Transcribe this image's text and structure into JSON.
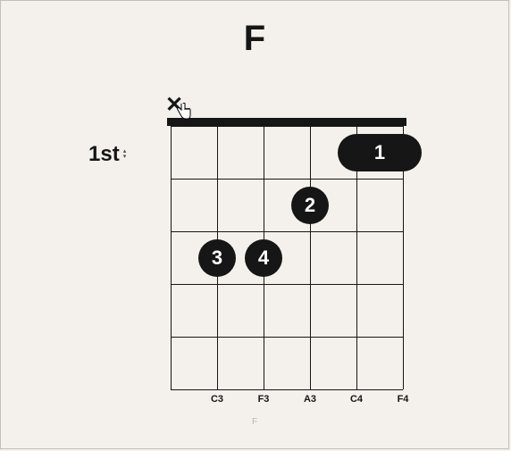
{
  "chord": {
    "name": "F",
    "footer": "F",
    "position_label": "1st",
    "strings": 6,
    "frets_shown": 5,
    "nut": true,
    "columns": [
      {
        "open_state": "muted",
        "note_label": ""
      },
      {
        "open_state": "fretted",
        "note_label": "C3"
      },
      {
        "open_state": "fretted",
        "note_label": "F3"
      },
      {
        "open_state": "fretted",
        "note_label": "A3"
      },
      {
        "open_state": "fretted",
        "note_label": "C4"
      },
      {
        "open_state": "fretted",
        "note_label": "F4"
      }
    ],
    "markers": [
      {
        "type": "barre",
        "finger": "1",
        "fret": 1,
        "from_string": 4,
        "to_string": 5
      },
      {
        "type": "dot",
        "finger": "2",
        "fret": 2,
        "string": 3
      },
      {
        "type": "dot",
        "finger": "3",
        "fret": 3,
        "string": 1
      },
      {
        "type": "dot",
        "finger": "4",
        "fret": 3,
        "string": 2
      }
    ]
  },
  "geometry": {
    "col_spacing": 52,
    "row_spacing": 59,
    "dot_size": 42
  }
}
